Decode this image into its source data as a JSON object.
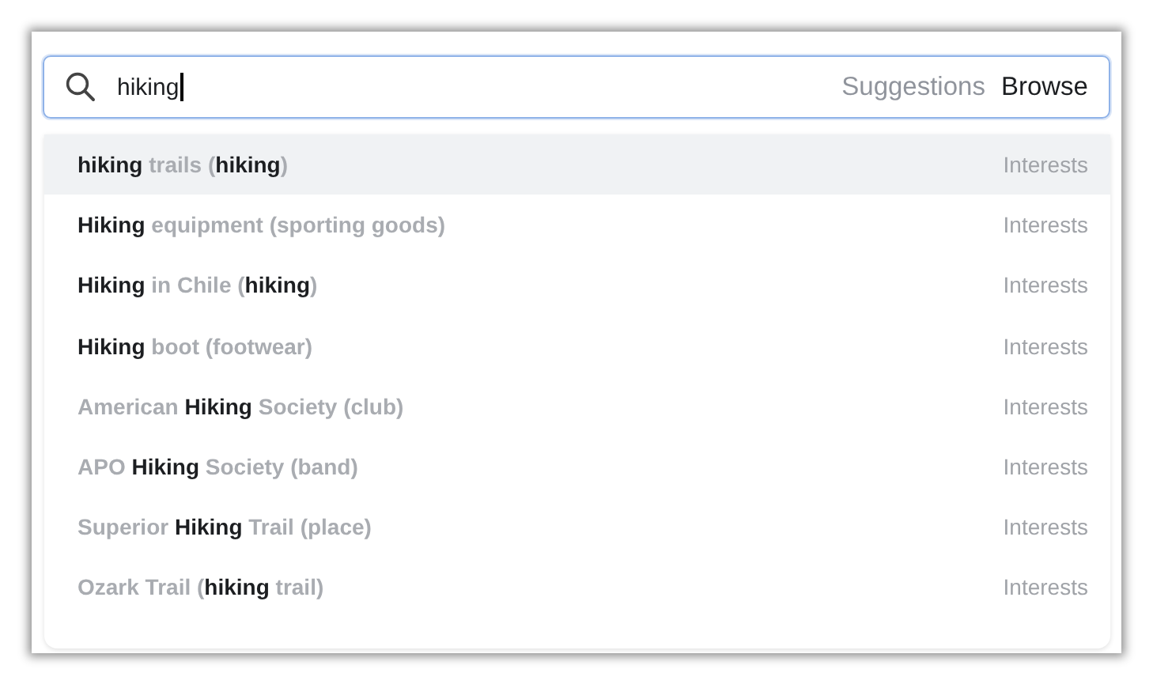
{
  "search": {
    "value": "hiking"
  },
  "tabs": [
    {
      "label": "Suggestions",
      "selected": false
    },
    {
      "label": "Browse",
      "selected": true
    }
  ],
  "results": [
    {
      "label": "**hiking** trails (**hiking**)",
      "category": "Interests",
      "selected": true
    },
    {
      "label": "**Hiking** equipment (sporting goods)",
      "category": "Interests",
      "selected": false
    },
    {
      "label": "**Hiking** in Chile (**hiking**)",
      "category": "Interests",
      "selected": false
    },
    {
      "label": "**Hiking** boot (footwear)",
      "category": "Interests",
      "selected": false
    },
    {
      "label": "American **Hiking** Society (club)",
      "category": "Interests",
      "selected": false
    },
    {
      "label": "APO **Hiking** Society (band)",
      "category": "Interests",
      "selected": false
    },
    {
      "label": "Superior **Hiking** Trail (place)",
      "category": "Interests",
      "selected": false
    },
    {
      "label": "Ozark Trail (**hiking** trail)",
      "category": "Interests",
      "selected": false
    }
  ]
}
